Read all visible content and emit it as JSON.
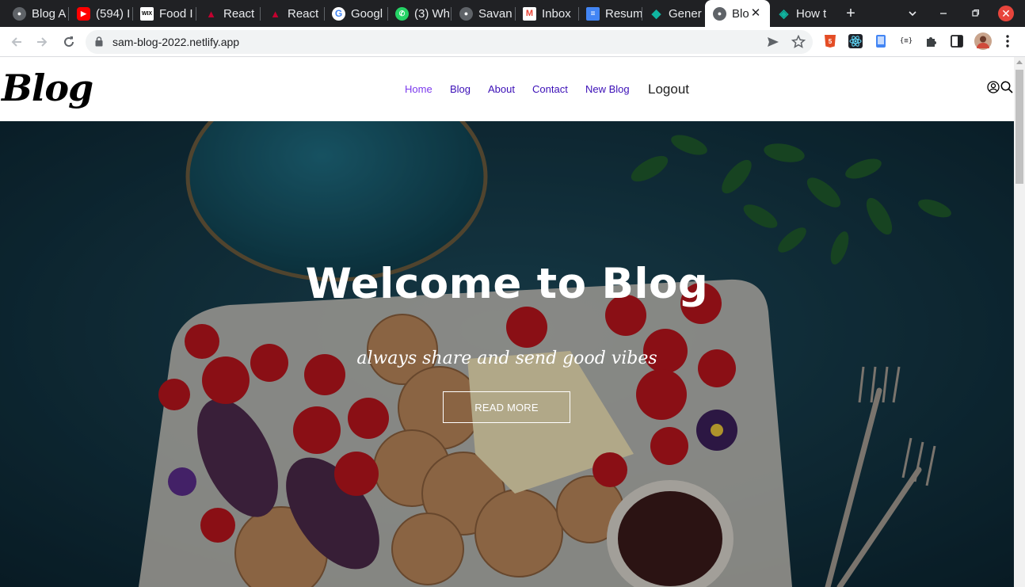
{
  "browser": {
    "tabs": [
      {
        "title": "Blog A",
        "icon": "globe-icon",
        "color": "#5f6368"
      },
      {
        "title": "(594) I",
        "icon": "youtube-icon",
        "color": "#ff0000"
      },
      {
        "title": "Food I",
        "icon": "wix-icon",
        "color": "#ffffff"
      },
      {
        "title": "React",
        "icon": "angular-react-icon",
        "color": "#c3002f"
      },
      {
        "title": "React",
        "icon": "angular-react-icon",
        "color": "#c3002f"
      },
      {
        "title": "Googl",
        "icon": "google-icon",
        "color": "#4285f4"
      },
      {
        "title": "(3) Wh",
        "icon": "whatsapp-icon",
        "color": "#25d366"
      },
      {
        "title": "Savan",
        "icon": "globe-icon",
        "color": "#5f6368"
      },
      {
        "title": "Inbox",
        "icon": "gmail-icon",
        "color": "#ea4335"
      },
      {
        "title": "Resum",
        "icon": "docs-icon",
        "color": "#4285f4"
      },
      {
        "title": "Gener",
        "icon": "diamond-icon",
        "color": "#10b4a0"
      },
      {
        "title": "Blo",
        "icon": "globe-icon",
        "color": "#5f6368",
        "active": true
      },
      {
        "title": "How t",
        "icon": "react-diamond-icon",
        "color": "#10b4a0"
      }
    ],
    "new_tab": "+",
    "tab_close": "✕",
    "url": "sam-blog-2022.netlify.app"
  },
  "site": {
    "logo": "Blog",
    "nav": {
      "home": "Home",
      "blog": "Blog",
      "about": "About",
      "contact": "Contact",
      "new_blog": "New Blog",
      "logout": "Logout"
    }
  },
  "hero": {
    "title": "Welcome to Blog",
    "subtitle": "always share and send good vibes",
    "button": "READ MORE"
  },
  "colors": {
    "nav_link": "#3b0fb7",
    "hero_overlay": "#0f2f3c",
    "tabstrip": "#202124"
  }
}
